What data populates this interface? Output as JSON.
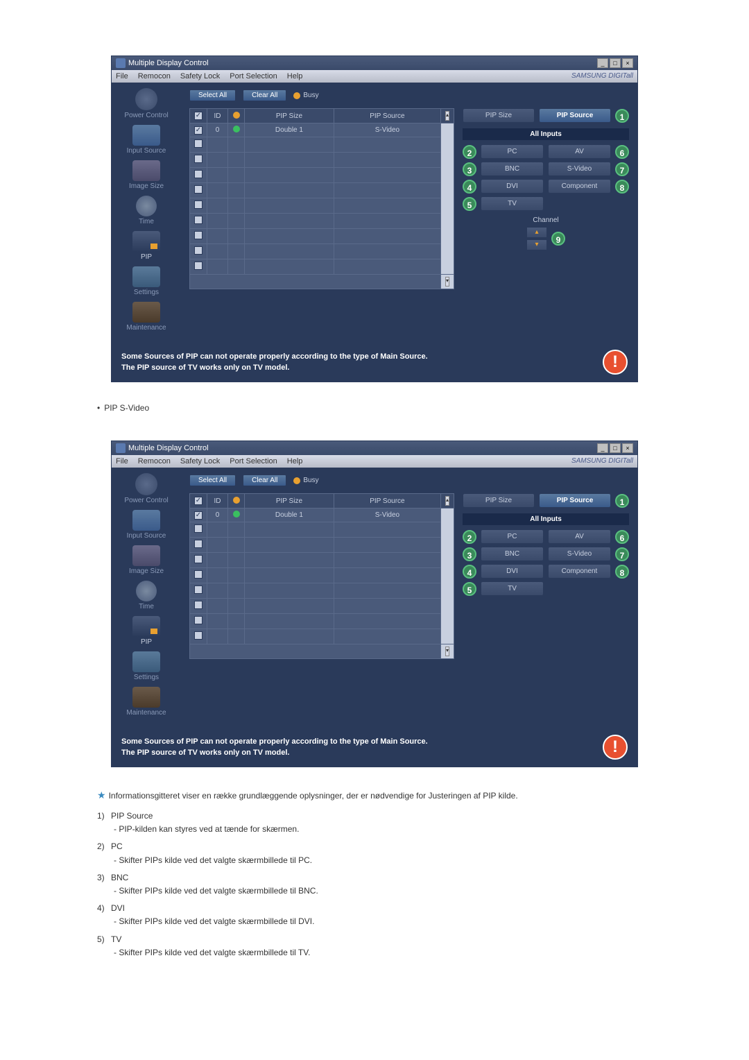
{
  "window": {
    "title": "Multiple Display Control",
    "menu": [
      "File",
      "Remocon",
      "Safety Lock",
      "Port Selection",
      "Help"
    ],
    "brand": "SAMSUNG DIGITall"
  },
  "sidebar": {
    "items": [
      {
        "label": "Power Control"
      },
      {
        "label": "Input Source"
      },
      {
        "label": "Image Size"
      },
      {
        "label": "Time"
      },
      {
        "label": "PIP"
      },
      {
        "label": "Settings"
      },
      {
        "label": "Maintenance"
      }
    ]
  },
  "toolbar": {
    "select_all": "Select All",
    "clear_all": "Clear All",
    "busy": "Busy"
  },
  "grid": {
    "headers": {
      "id": "ID",
      "pip_size": "PIP Size",
      "pip_source": "PIP Source"
    },
    "row": {
      "id": "0",
      "pip_size": "Double 1",
      "pip_source": "S-Video"
    }
  },
  "panel": {
    "tabs": {
      "size": "PIP Size",
      "source": "PIP Source"
    },
    "all_inputs": "All Inputs",
    "inputs_left": [
      "PC",
      "BNC",
      "DVI",
      "TV"
    ],
    "inputs_right": [
      "AV",
      "S-Video",
      "Component"
    ],
    "badges_left": [
      "2",
      "3",
      "4",
      "5"
    ],
    "badges_right": [
      "6",
      "7",
      "8"
    ],
    "channel": "Channel",
    "badge_1": "1",
    "badge_9": "9"
  },
  "footer": {
    "line1": "Some Sources of PIP can not operate properly according to the type of Main Source.",
    "line2": "The PIP source of TV works only on TV model."
  },
  "section2_label": "PIP S-Video",
  "info_intro": "Informationsgitteret viser en række grundlæggende oplysninger, der er nødvendige for Justeringen af PIP kilde.",
  "info_items": [
    {
      "num": "1)",
      "title": "PIP Source",
      "desc": "- PIP-kilden kan styres ved at tænde for skærmen."
    },
    {
      "num": "2)",
      "title": "PC",
      "desc": "- Skifter PIPs kilde ved det valgte skærmbillede til PC."
    },
    {
      "num": "3)",
      "title": "BNC",
      "desc": "- Skifter PIPs kilde ved det valgte skærmbillede til BNC."
    },
    {
      "num": "4)",
      "title": "DVI",
      "desc": "- Skifter PIPs kilde ved det valgte skærmbillede til DVI."
    },
    {
      "num": "5)",
      "title": "TV",
      "desc": "- Skifter PIPs kilde ved det valgte skærmbillede til TV."
    }
  ]
}
